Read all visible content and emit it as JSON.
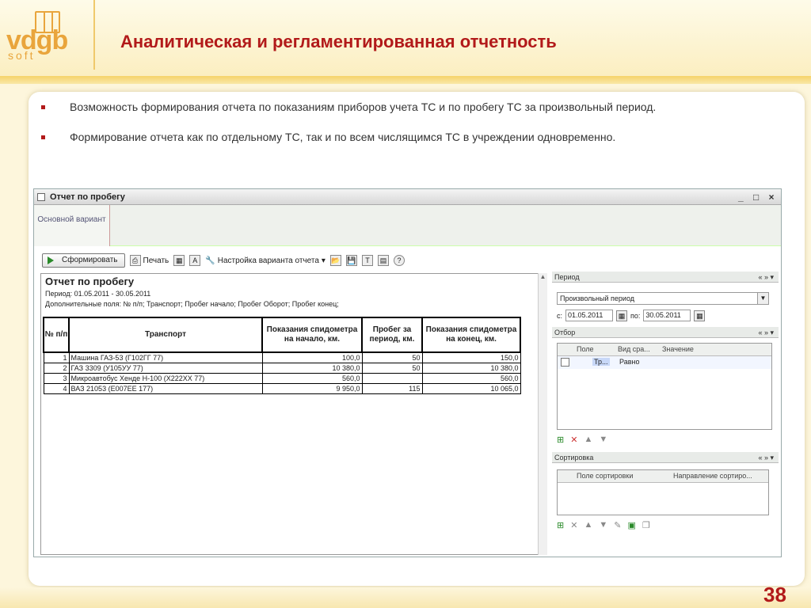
{
  "logo": {
    "text": "vdgb",
    "sub": "soft"
  },
  "title": "Аналитическая и регламентированная отчетность",
  "bullets": [
    "Возможность формирования отчета по показаниям приборов учета ТС и по пробегу ТС за произвольный период.",
    "Формирование отчета как по отдельному ТС, так и по всем числящимся ТС в учреждении одновременно."
  ],
  "window": {
    "title": "Отчет по пробегу",
    "controls": [
      "_",
      "□",
      "×"
    ],
    "tab": "Основной вариант",
    "toolbar": {
      "form_button": "Сформировать",
      "print": "Печать",
      "settings": "Настройка варианта отчета"
    }
  },
  "report": {
    "title": "Отчет по пробегу",
    "period": "Период: 01.05.2011 - 30.05.2011",
    "fields": "Дополнительные поля: № п/п; Транспорт; Пробег начало; Пробег Оборот; Пробег конец;",
    "headers": [
      "№ п/п",
      "Транспорт",
      "Показания спидометра на начало, км.",
      "Пробег за период, км.",
      "Показания спидометра на конец, км."
    ],
    "rows": [
      [
        "1",
        "Машина ГАЗ-53 (Г102ГГ 77)",
        "100,0",
        "50",
        "150,0"
      ],
      [
        "2",
        "ГАЗ 3309 (У105УУ 77)",
        "10 380,0",
        "50",
        "10 380,0"
      ],
      [
        "3",
        "Микроавтобус Хенде Н-100 (Х222ХХ 77)",
        "560,0",
        "",
        "560,0"
      ],
      [
        "4",
        "ВАЗ 21053 (Е007ЕЕ 177)",
        "9 950,0",
        "115",
        "10 065,0"
      ]
    ]
  },
  "side": {
    "period_header": "Период",
    "period_value": "Произвольный период",
    "from_label": "с:",
    "from_value": "01.05.2011",
    "to_label": "по:",
    "to_value": "30.05.2011",
    "filter_header": "Отбор",
    "filter_cols": [
      "Поле",
      "Вид сра...",
      "Значение"
    ],
    "filter_row": {
      "field": "Тр...",
      "kind": "Равно"
    },
    "sort_header": "Сортировка",
    "sort_cols": [
      "Поле сортировки",
      "Направление сортиро..."
    ],
    "arrows": "« » ▾"
  },
  "page_number": "38"
}
